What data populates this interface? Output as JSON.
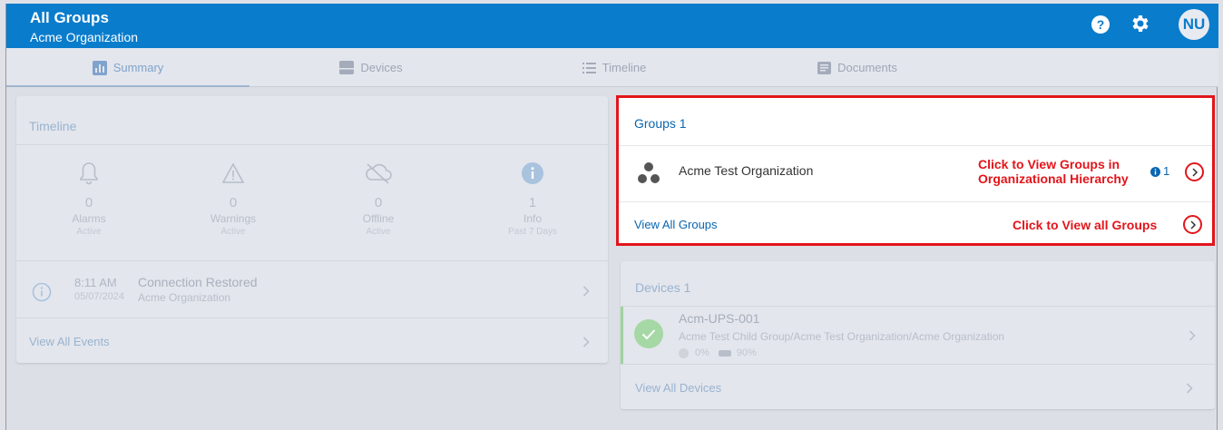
{
  "header": {
    "title": "All Groups",
    "subtitle": "Acme Organization",
    "avatar_initials": "NU",
    "help_glyph": "?"
  },
  "tabs": [
    {
      "label": "Summary",
      "icon": "bar-chart-icon",
      "active": true
    },
    {
      "label": "Devices",
      "icon": "device-icon",
      "active": false
    },
    {
      "label": "Timeline",
      "icon": "list-icon",
      "active": false
    },
    {
      "label": "Documents",
      "icon": "document-icon",
      "active": false
    }
  ],
  "timeline": {
    "title": "Timeline",
    "stats": [
      {
        "value": "0",
        "label": "Alarms",
        "sub": "Active",
        "icon": "bell-icon"
      },
      {
        "value": "0",
        "label": "Warnings",
        "sub": "Active",
        "icon": "warning-icon"
      },
      {
        "value": "0",
        "label": "Offline",
        "sub": "Active",
        "icon": "cloud-offline-icon"
      },
      {
        "value": "1",
        "label": "Info",
        "sub": "Past 7 Days",
        "icon": "info-icon"
      }
    ],
    "event": {
      "time": "8:11 AM",
      "date": "05/07/2024",
      "title": "Connection Restored",
      "source": "Acme Organization"
    },
    "view_all": "View All Events"
  },
  "groups": {
    "title": "Groups 1",
    "item_name": "Acme Test Organization",
    "item_count": "1",
    "note_line1": "Click to View Groups in",
    "note_line2": "Organizational Hierarchy",
    "view_all": "View All Groups",
    "view_all_note": "Click to View all Groups"
  },
  "devices": {
    "title": "Devices 1",
    "device_name": "Acm-UPS-001",
    "device_path": "Acme Test Child Group/Acme Test Organization/Acme Organization",
    "metric1": "0%",
    "metric2": "90%",
    "view_all": "View All Devices"
  },
  "colors": {
    "brand": "#0a7ccc",
    "highlight": "#e2151b",
    "link": "#0a66b0",
    "status_ok": "#7fd07f"
  }
}
